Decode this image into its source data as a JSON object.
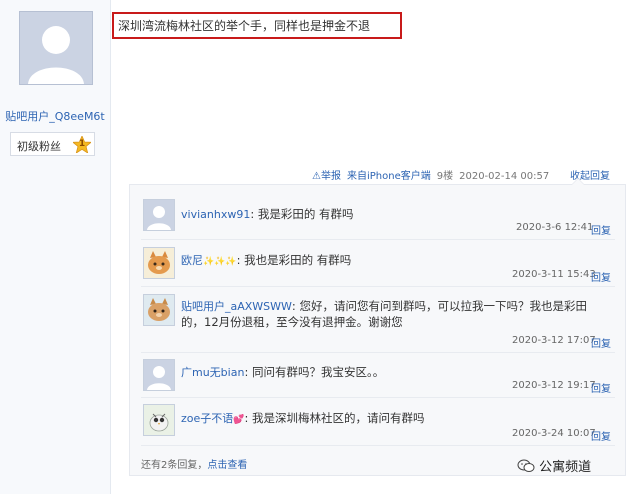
{
  "op": {
    "username": "贴吧用户_Q8eeM6t",
    "fan_badge": "初级粉丝",
    "fan_level": "1",
    "post_text": "深圳湾流梅林社区的举个手，同样也是押金不退"
  },
  "meta": {
    "report": "举报",
    "device": "来自iPhone客户端",
    "floor": "9楼",
    "datetime": "2020-02-14 00:57",
    "collapse": "收起回复"
  },
  "replies": [
    {
      "name": "vivianhxw91",
      "text": ": 我是彩田的 有群吗",
      "time": "2020-3-6 12:41",
      "reply": "回复",
      "avatar": "default-avatar-icon"
    },
    {
      "name": "欧尼",
      "decor": "✨✨✨",
      "text": ": 我也是彩田的 有群吗",
      "time": "2020-3-11 15:43",
      "reply": "回复",
      "avatar": "cat-avatar-icon"
    },
    {
      "name": "贴吧用户_aAXWSWW",
      "text": ": 您好，请问您有问到群吗，可以拉我一下吗？我也是彩田",
      "text2": "的，12月份退租，至今没有退押金。谢谢您",
      "time": "2020-3-12 17:07",
      "reply": "回复",
      "avatar": "cat-avatar-icon"
    },
    {
      "name": "广mu无bian",
      "text": ": 同问有群吗？我宝安区。。",
      "time": "2020-3-12 19:17",
      "reply": "回复",
      "avatar": "default-avatar-icon"
    },
    {
      "name": "zoe子不语",
      "decor": "💕",
      "text": ": 我是深圳梅林社区的，请问有群吗",
      "time": "2020-3-24 10:07",
      "reply": "回复",
      "avatar": "bird-avatar-icon"
    }
  ],
  "more": {
    "prefix": "还有2条回复，",
    "link": "点击查看"
  },
  "watermark": "公寓频道"
}
